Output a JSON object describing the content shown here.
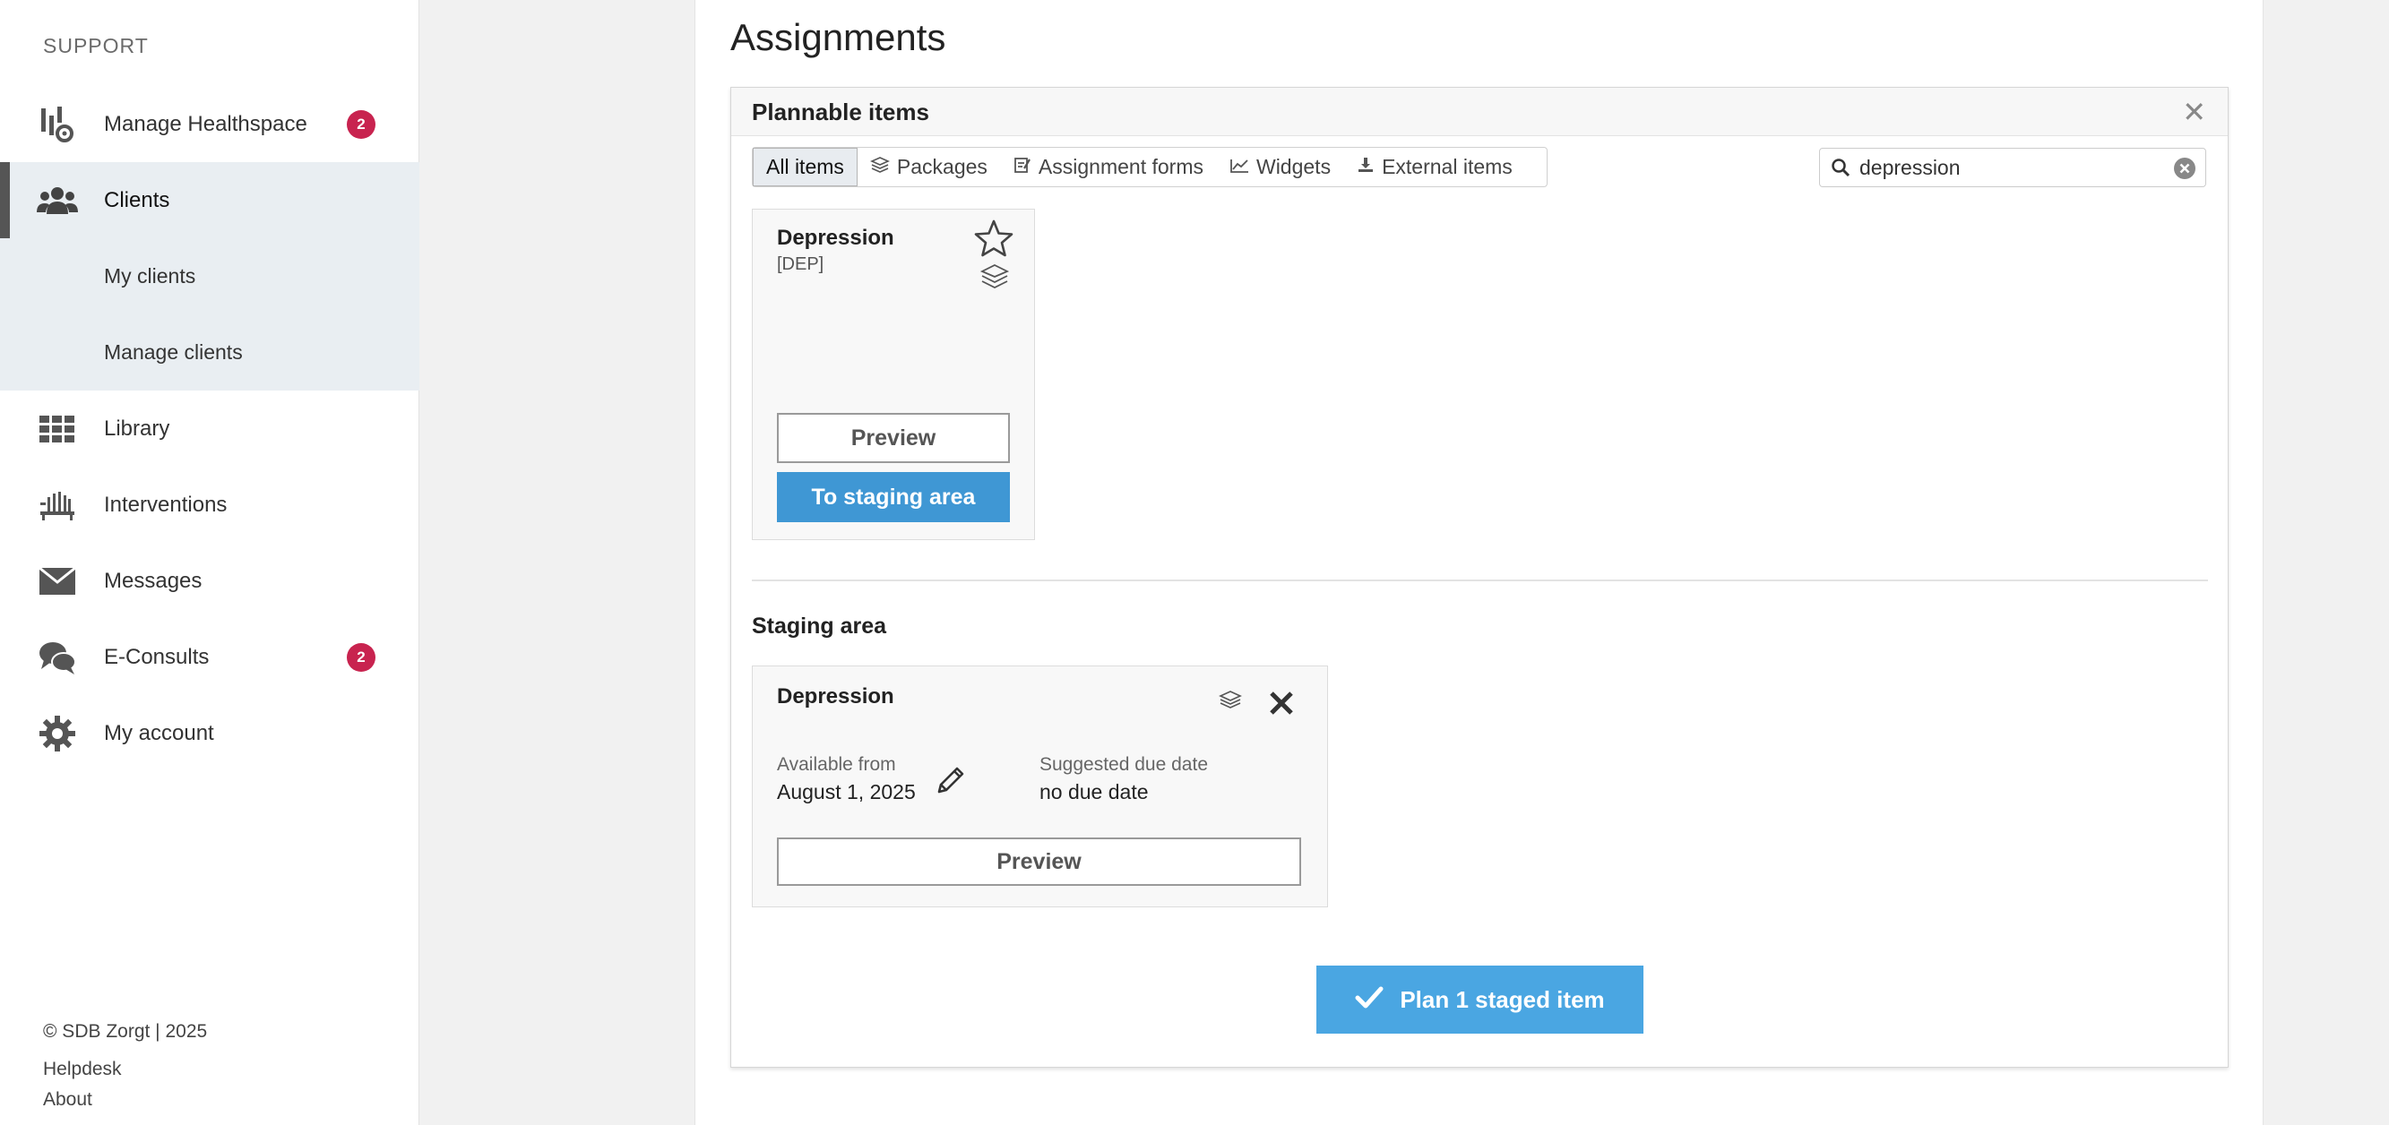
{
  "sidebar": {
    "section_title": "SUPPORT",
    "items": [
      {
        "label": "Manage Healthspace",
        "icon": "healthspace-icon",
        "badge": "2"
      },
      {
        "label": "Clients",
        "icon": "users-icon"
      },
      {
        "label": "My clients"
      },
      {
        "label": "Manage clients"
      },
      {
        "label": "Library",
        "icon": "grid-icon"
      },
      {
        "label": "Interventions",
        "icon": "interventions-icon"
      },
      {
        "label": "Messages",
        "icon": "envelope-icon"
      },
      {
        "label": "E-Consults",
        "icon": "chat-icon",
        "badge": "2"
      },
      {
        "label": "My account",
        "icon": "gear-icon"
      }
    ],
    "footer": {
      "copyright": "© SDB Zorgt | 2025",
      "helpdesk": "Helpdesk",
      "about": "About"
    }
  },
  "main": {
    "page_title": "Assignments",
    "plannable": {
      "title": "Plannable items",
      "filters": [
        {
          "label": "All items",
          "active": true
        },
        {
          "label": "Packages",
          "icon": "layers-icon"
        },
        {
          "label": "Assignment forms",
          "icon": "form-icon"
        },
        {
          "label": "Widgets",
          "icon": "chart-icon"
        },
        {
          "label": "External items",
          "icon": "download-icon"
        }
      ],
      "search": {
        "value": "depression"
      },
      "items": [
        {
          "title": "Depression",
          "code": "[DEP]",
          "preview_label": "Preview",
          "stage_label": "To staging area"
        }
      ]
    },
    "staging": {
      "title": "Staging area",
      "items": [
        {
          "title": "Depression",
          "available_label": "Available from",
          "available_value": "August 1, 2025",
          "due_label": "Suggested due date",
          "due_value": "no due date",
          "preview_label": "Preview"
        }
      ]
    },
    "plan_button_label": "Plan 1 staged item"
  },
  "colors": {
    "accent": "#3f97d4",
    "badge": "#c8234f",
    "active_nav": "#e9eef2"
  }
}
